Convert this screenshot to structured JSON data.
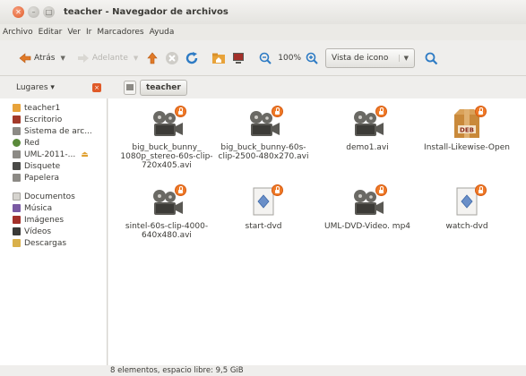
{
  "window": {
    "title": "teacher - Navegador de archivos"
  },
  "menubar": [
    "Archivo",
    "Editar",
    "Ver",
    "Ir",
    "Marcadores",
    "Ayuda"
  ],
  "toolbar": {
    "back_label": "Atrás",
    "forward_label": "Adelante",
    "zoom_value": "100%",
    "view_mode": "Vista de icono"
  },
  "location": {
    "places_label": "Lugares ▾",
    "crumb": "teacher"
  },
  "sidebar": {
    "items": [
      {
        "label": "teacher1",
        "color": "#e8a33a"
      },
      {
        "label": "Escritorio",
        "color": "#a33a2a"
      },
      {
        "label": "Sistema de arc...",
        "color": "#8c8a85"
      },
      {
        "label": "Red",
        "color": "#5a8a3a"
      },
      {
        "label": "UML-2011-...",
        "color": "#8c8a85"
      },
      {
        "label": "Disquete",
        "color": "#4a4a48"
      },
      {
        "label": "Papelera",
        "color": "#8c8a85"
      },
      {
        "label": "Documentos",
        "color": "#d6d4cf"
      },
      {
        "label": "Música",
        "color": "#7a5aa3"
      },
      {
        "label": "Imágenes",
        "color": "#a3302a"
      },
      {
        "label": "Vídeos",
        "color": "#3a3a38"
      },
      {
        "label": "Descargas",
        "color": "#d9b04a"
      }
    ]
  },
  "files": [
    {
      "name": "big_buck_bunny_ 1080p_stereo-60s-clip-720x405.avi",
      "type": "video"
    },
    {
      "name": "big_buck_bunny-60s-clip-2500-480x270.avi",
      "type": "video"
    },
    {
      "name": "demo1.avi",
      "type": "video"
    },
    {
      "name": "Install-Likewise-Open",
      "type": "deb"
    },
    {
      "name": "sintel-60s-clip-4000-640x480.avi",
      "type": "video"
    },
    {
      "name": "start-dvd",
      "type": "script"
    },
    {
      "name": "UML-DVD-Video. mp4",
      "type": "video"
    },
    {
      "name": "watch-dvd",
      "type": "script"
    }
  ],
  "statusbar": {
    "text": "8 elementos, espacio libre: 9,5 GiB"
  }
}
